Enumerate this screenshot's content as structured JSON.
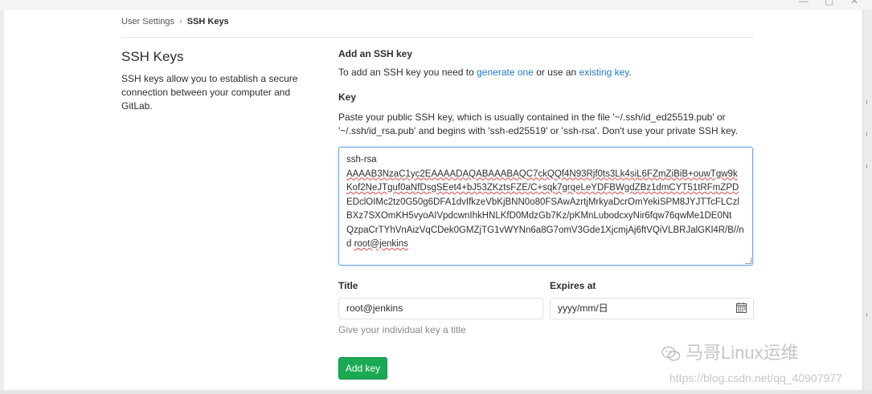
{
  "breadcrumb": {
    "parent": "User Settings",
    "separator": "›",
    "current": "SSH Keys"
  },
  "sidebar": {
    "title": "SSH Keys",
    "description": "SSH keys allow you to establish a secure connection between your computer and GitLab."
  },
  "add_section": {
    "heading": "Add an SSH key",
    "intro_prefix": "To add an SSH key you need to ",
    "link_generate": "generate one",
    "intro_middle": " or use an ",
    "link_existing": "existing key",
    "intro_suffix": "."
  },
  "key_field": {
    "label": "Key",
    "help": "Paste your public SSH key, which is usually contained in the file '~/.ssh/id_ed25519.pub' or '~/.ssh/id_rsa.pub' and begins with 'ssh-ed25519' or 'ssh-rsa'. Don't use your private SSH key.",
    "lines": [
      "ssh-rsa",
      "AAAAB3NzaC1yc2EAAAADAQABAAABAQC7ckQQf4N93Rjf0ts3Lk4siL6FZmZiBiB+ouwTgw9k",
      "Kof2NeJTguf0aNfDsgSEet4+bJ53ZKztsFZE/C+sqk7grqeLeYDFBWgdZBz1dmCYT51tRFmZPD",
      "EDclOIMc2tz0G50g6DFA1dvIfkzeVbKjBNN0o80FSAwAzrtjMrkyaDcrOmYekiSPM8JYJTTcFLCzl",
      "BXz7SXOmKH5vyoAIVpdcwnIhkHNLKfD0MdzGb7Kz/pKMnLubodcxyNir6fqw76qwMe1DE0Nt",
      "QzpaCrTYhVnAizVqCDek0GMZjTG1vWYNn6a8G7omV3Gde1XjcmjAj6ftVQiVLBRJalGKl4R/B//n",
      "d root@jenkins"
    ],
    "last_line_prefix": "d ",
    "last_line_host": "root@jenkins"
  },
  "title_field": {
    "label": "Title",
    "value": "root@jenkins",
    "hint": "Give your individual key a title"
  },
  "expires_field": {
    "label": "Expires at",
    "placeholder": "yyyy/mm/日"
  },
  "add_button": {
    "label": "Add key"
  },
  "watermark": {
    "brand": "马哥Linux运维",
    "url": "https://blog.csdn.net/qq_40907977"
  },
  "icons": {
    "calendar": "calendar-icon",
    "wechat": "wechat-icon",
    "resize": "resize-handle-icon"
  },
  "colors": {
    "link": "#1f78d1",
    "button": "#1aaa55",
    "focus_border": "#6ea8e6"
  }
}
